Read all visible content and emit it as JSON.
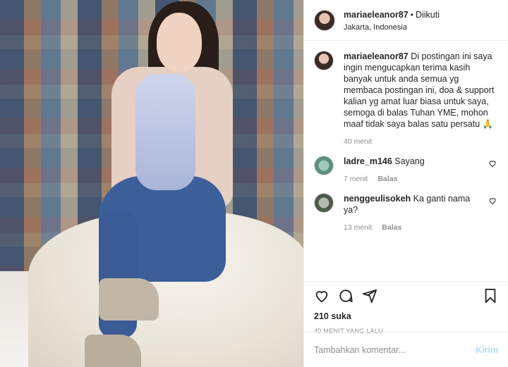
{
  "post": {
    "username": "mariaeleanor87",
    "follow_status": "Diikuti",
    "location": "Jakarta, Indonesia"
  },
  "caption": {
    "username": "mariaeleanor87",
    "text": "Di postingan ini saya ingin mengucapkan terima kasih banyak untuk anda semua yg membaca postingan ini, doa & support kalian yg amat luar biasa untuk saya, semoga di balas Tuhan YME, mohon maaf tidak saya balas satu persatu 🙏",
    "time": "40 menit"
  },
  "comments": [
    {
      "username": "ladre_m146",
      "text": "Sayang",
      "time": "7 menit",
      "reply": "Balas"
    },
    {
      "username": "nenggeulisokeh",
      "text": "Ka ganti nama ya?",
      "time": "13 menit",
      "reply": "Balas"
    }
  ],
  "likes": "210 suka",
  "timestamp": "40 MENIT YANG LALU",
  "comment_box": {
    "placeholder": "Tambahkan komentar...",
    "send_label": "Kirim"
  },
  "icons": [
    "heart-icon",
    "comment-icon",
    "share-icon",
    "bookmark-icon"
  ],
  "colors": {
    "send_disabled": "#b2dffc",
    "muted": "#8e8e8e"
  }
}
